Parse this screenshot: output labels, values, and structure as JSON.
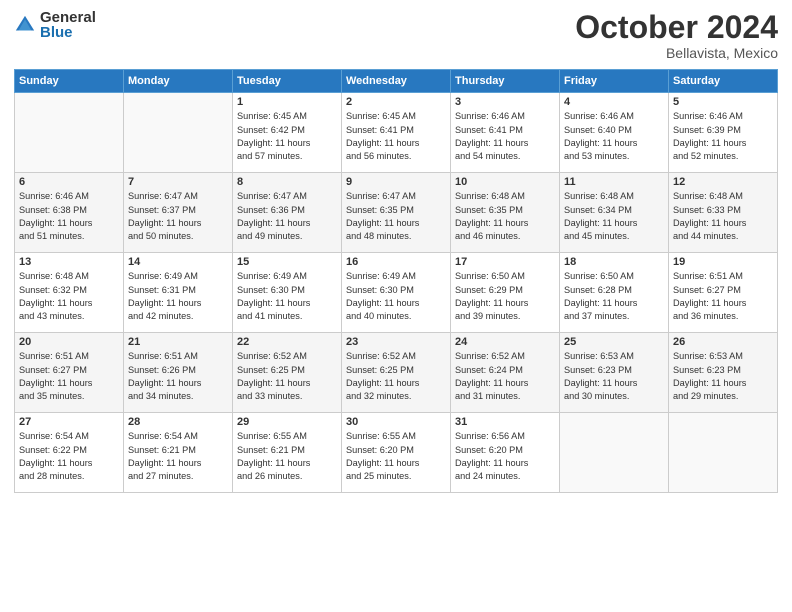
{
  "logo": {
    "general": "General",
    "blue": "Blue"
  },
  "title": "October 2024",
  "subtitle": "Bellavista, Mexico",
  "days_of_week": [
    "Sunday",
    "Monday",
    "Tuesday",
    "Wednesday",
    "Thursday",
    "Friday",
    "Saturday"
  ],
  "weeks": [
    [
      {
        "day": "",
        "info": ""
      },
      {
        "day": "",
        "info": ""
      },
      {
        "day": "1",
        "info": "Sunrise: 6:45 AM\nSunset: 6:42 PM\nDaylight: 11 hours\nand 57 minutes."
      },
      {
        "day": "2",
        "info": "Sunrise: 6:45 AM\nSunset: 6:41 PM\nDaylight: 11 hours\nand 56 minutes."
      },
      {
        "day": "3",
        "info": "Sunrise: 6:46 AM\nSunset: 6:41 PM\nDaylight: 11 hours\nand 54 minutes."
      },
      {
        "day": "4",
        "info": "Sunrise: 6:46 AM\nSunset: 6:40 PM\nDaylight: 11 hours\nand 53 minutes."
      },
      {
        "day": "5",
        "info": "Sunrise: 6:46 AM\nSunset: 6:39 PM\nDaylight: 11 hours\nand 52 minutes."
      }
    ],
    [
      {
        "day": "6",
        "info": "Sunrise: 6:46 AM\nSunset: 6:38 PM\nDaylight: 11 hours\nand 51 minutes."
      },
      {
        "day": "7",
        "info": "Sunrise: 6:47 AM\nSunset: 6:37 PM\nDaylight: 11 hours\nand 50 minutes."
      },
      {
        "day": "8",
        "info": "Sunrise: 6:47 AM\nSunset: 6:36 PM\nDaylight: 11 hours\nand 49 minutes."
      },
      {
        "day": "9",
        "info": "Sunrise: 6:47 AM\nSunset: 6:35 PM\nDaylight: 11 hours\nand 48 minutes."
      },
      {
        "day": "10",
        "info": "Sunrise: 6:48 AM\nSunset: 6:35 PM\nDaylight: 11 hours\nand 46 minutes."
      },
      {
        "day": "11",
        "info": "Sunrise: 6:48 AM\nSunset: 6:34 PM\nDaylight: 11 hours\nand 45 minutes."
      },
      {
        "day": "12",
        "info": "Sunrise: 6:48 AM\nSunset: 6:33 PM\nDaylight: 11 hours\nand 44 minutes."
      }
    ],
    [
      {
        "day": "13",
        "info": "Sunrise: 6:48 AM\nSunset: 6:32 PM\nDaylight: 11 hours\nand 43 minutes."
      },
      {
        "day": "14",
        "info": "Sunrise: 6:49 AM\nSunset: 6:31 PM\nDaylight: 11 hours\nand 42 minutes."
      },
      {
        "day": "15",
        "info": "Sunrise: 6:49 AM\nSunset: 6:30 PM\nDaylight: 11 hours\nand 41 minutes."
      },
      {
        "day": "16",
        "info": "Sunrise: 6:49 AM\nSunset: 6:30 PM\nDaylight: 11 hours\nand 40 minutes."
      },
      {
        "day": "17",
        "info": "Sunrise: 6:50 AM\nSunset: 6:29 PM\nDaylight: 11 hours\nand 39 minutes."
      },
      {
        "day": "18",
        "info": "Sunrise: 6:50 AM\nSunset: 6:28 PM\nDaylight: 11 hours\nand 37 minutes."
      },
      {
        "day": "19",
        "info": "Sunrise: 6:51 AM\nSunset: 6:27 PM\nDaylight: 11 hours\nand 36 minutes."
      }
    ],
    [
      {
        "day": "20",
        "info": "Sunrise: 6:51 AM\nSunset: 6:27 PM\nDaylight: 11 hours\nand 35 minutes."
      },
      {
        "day": "21",
        "info": "Sunrise: 6:51 AM\nSunset: 6:26 PM\nDaylight: 11 hours\nand 34 minutes."
      },
      {
        "day": "22",
        "info": "Sunrise: 6:52 AM\nSunset: 6:25 PM\nDaylight: 11 hours\nand 33 minutes."
      },
      {
        "day": "23",
        "info": "Sunrise: 6:52 AM\nSunset: 6:25 PM\nDaylight: 11 hours\nand 32 minutes."
      },
      {
        "day": "24",
        "info": "Sunrise: 6:52 AM\nSunset: 6:24 PM\nDaylight: 11 hours\nand 31 minutes."
      },
      {
        "day": "25",
        "info": "Sunrise: 6:53 AM\nSunset: 6:23 PM\nDaylight: 11 hours\nand 30 minutes."
      },
      {
        "day": "26",
        "info": "Sunrise: 6:53 AM\nSunset: 6:23 PM\nDaylight: 11 hours\nand 29 minutes."
      }
    ],
    [
      {
        "day": "27",
        "info": "Sunrise: 6:54 AM\nSunset: 6:22 PM\nDaylight: 11 hours\nand 28 minutes."
      },
      {
        "day": "28",
        "info": "Sunrise: 6:54 AM\nSunset: 6:21 PM\nDaylight: 11 hours\nand 27 minutes."
      },
      {
        "day": "29",
        "info": "Sunrise: 6:55 AM\nSunset: 6:21 PM\nDaylight: 11 hours\nand 26 minutes."
      },
      {
        "day": "30",
        "info": "Sunrise: 6:55 AM\nSunset: 6:20 PM\nDaylight: 11 hours\nand 25 minutes."
      },
      {
        "day": "31",
        "info": "Sunrise: 6:56 AM\nSunset: 6:20 PM\nDaylight: 11 hours\nand 24 minutes."
      },
      {
        "day": "",
        "info": ""
      },
      {
        "day": "",
        "info": ""
      }
    ]
  ]
}
